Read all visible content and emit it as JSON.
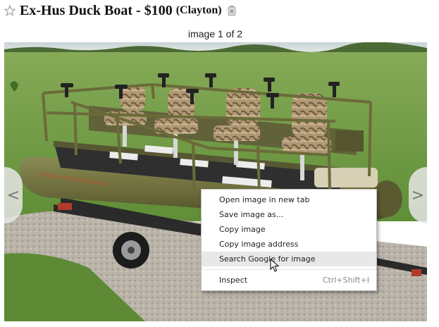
{
  "listing": {
    "title": "Ex-Hus Duck Boat - $100",
    "location": "(Clayton)"
  },
  "gallery": {
    "counter": "image 1 of 2",
    "prev_arrow": "<",
    "next_arrow": ">"
  },
  "context_menu": {
    "items": [
      {
        "label": "Open image in new tab",
        "shortcut": ""
      },
      {
        "label": "Save image as...",
        "shortcut": ""
      },
      {
        "label": "Copy image",
        "shortcut": ""
      },
      {
        "label": "Copy image address",
        "shortcut": ""
      },
      {
        "label": "Search Google for image",
        "shortcut": ""
      },
      {
        "label": "Inspect",
        "shortcut": "Ctrl+Shift+I"
      }
    ],
    "highlighted_item": "Search Google for image"
  },
  "photo": {
    "subject": "olive green pontoon duck boat with camouflage seats on a trailer",
    "boat_decal": "Dream Hunting Boats"
  },
  "icons": {
    "favorite": "star-icon",
    "hide": "hide-icon",
    "cursor": "mouse-pointer-icon"
  },
  "colors": {
    "boat_olive": "#6f6f3e",
    "grass": "#6f9a42",
    "menu_highlight": "#e8e8e8",
    "text": "#111111"
  }
}
